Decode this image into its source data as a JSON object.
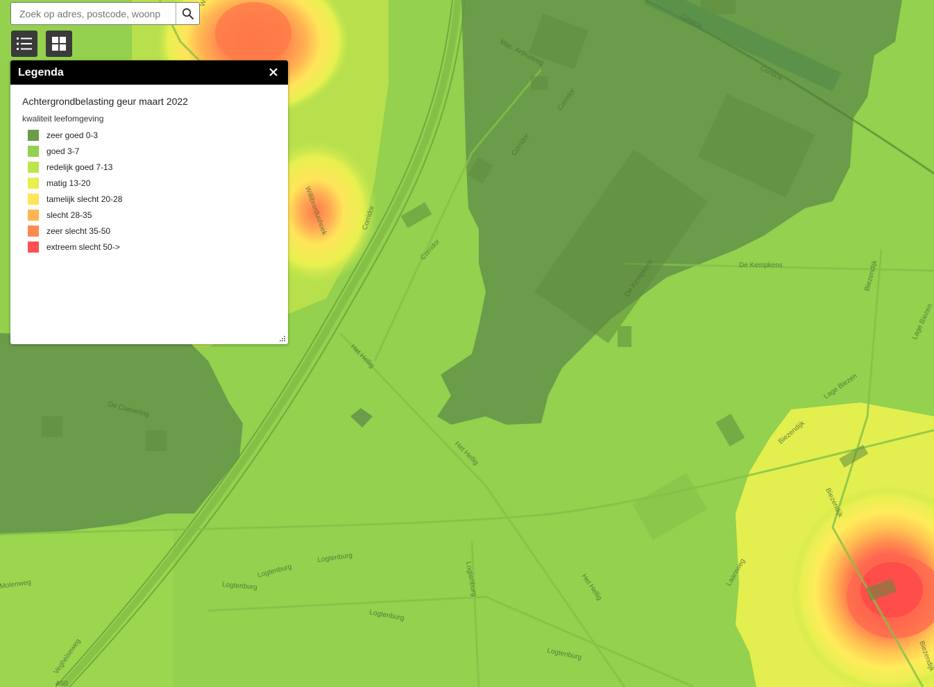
{
  "search": {
    "placeholder": "Zoek op adres, postcode, woonp"
  },
  "toolbar": {
    "layers_icon": "layer-list-icon",
    "basemap_icon": "basemap-gallery-icon",
    "search_icon": "search-icon"
  },
  "legend": {
    "header": "Legenda",
    "layer_title": "Achtergrondbelasting geur maart 2022",
    "subtitle": "kwaliteit leefomgeving",
    "items": [
      {
        "label": "zeer goed 0-3",
        "color": "#6a9c4a"
      },
      {
        "label": "goed 3-7",
        "color": "#93d14e"
      },
      {
        "label": "redelijk goed 7-13",
        "color": "#bde54c"
      },
      {
        "label": "matig 13-20",
        "color": "#e8f04f"
      },
      {
        "label": "tamelijk slecht 20-28",
        "color": "#ffe55a"
      },
      {
        "label": "slecht 28-35",
        "color": "#ffb552"
      },
      {
        "label": "zeer slecht 35-50",
        "color": "#ff8a4e"
      },
      {
        "label": "extreem slecht 50->",
        "color": "#ff5252"
      }
    ]
  },
  "map": {
    "streets": [
      "Mac. Arthurweg",
      "Corsica",
      "Corsica",
      "Corridor",
      "Corridor",
      "Corridor",
      "Corridor",
      "Willibrordushoek",
      "De Kempkens",
      "De Kempkens",
      "Biezendijk",
      "Biezendijk",
      "Biezendijk",
      "Lage Biezen",
      "Lage Biezen",
      "Het Hellig",
      "Het Hellig",
      "Het Hellig",
      "De Coevering",
      "Logtenburg",
      "Logtenburg",
      "Logtenburg",
      "Logtenburg",
      "Logtenburg",
      "Logtenburg",
      "Laarsweg",
      "Veghelseweg",
      "Molenweg",
      "Biezendijk",
      "Willibrordushoek",
      "A50"
    ]
  }
}
